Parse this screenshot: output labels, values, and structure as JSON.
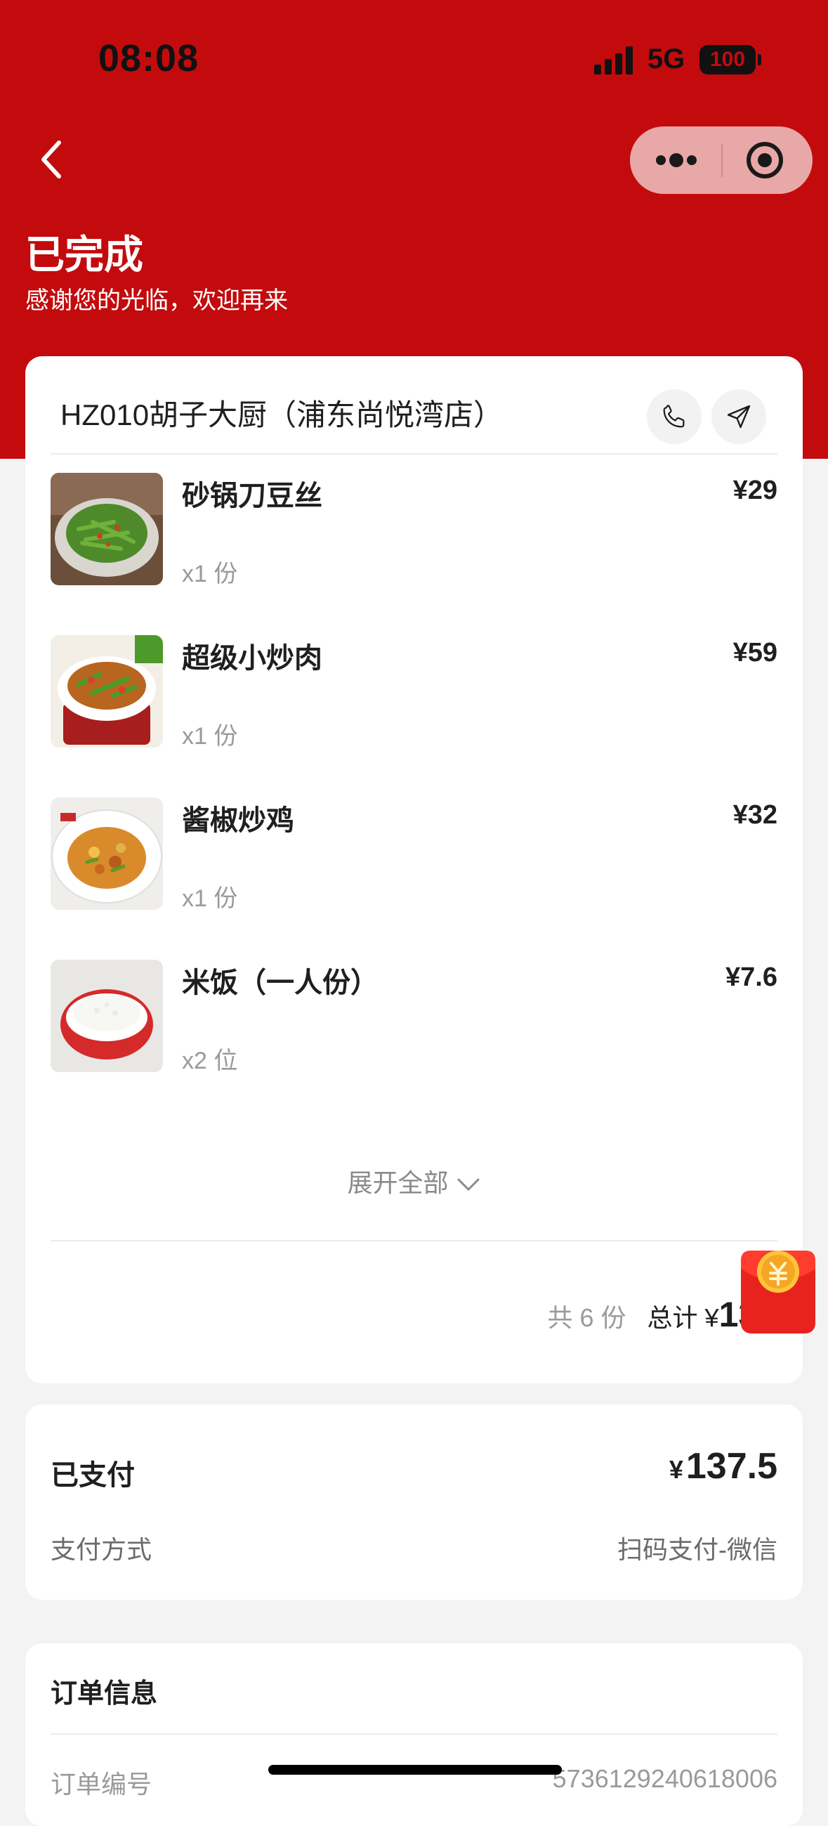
{
  "status_bar": {
    "time": "08:08",
    "network": "5G",
    "battery": "100"
  },
  "header": {
    "status": "已完成",
    "subtitle": "感谢您的光临，欢迎再来",
    "bg_color": "#c30b0d"
  },
  "store": {
    "name": "HZ010胡子大厨（浦东尚悦湾店）"
  },
  "dishes": [
    {
      "name": "砂锅刀豆丝",
      "qty": "x1 份",
      "price": "¥29"
    },
    {
      "name": "超级小炒肉",
      "qty": "x1 份",
      "price": "¥59"
    },
    {
      "name": "酱椒炒鸡",
      "qty": "x1 份",
      "price": "¥32"
    },
    {
      "name": "米饭（一人份）",
      "qty": "x2 位",
      "price": "¥7.6"
    }
  ],
  "expand": {
    "label": "展开全部"
  },
  "totals": {
    "count": "共 6 份",
    "label": "总计",
    "currency": "¥",
    "value": "137"
  },
  "payment": {
    "label": "已支付",
    "currency": "¥",
    "amount": "137.5",
    "method_label": "支付方式",
    "method_value": "扫码支付-微信"
  },
  "order_info": {
    "title": "订单信息",
    "order_no_label": "订单编号",
    "order_no_value": "5736129240618006"
  }
}
